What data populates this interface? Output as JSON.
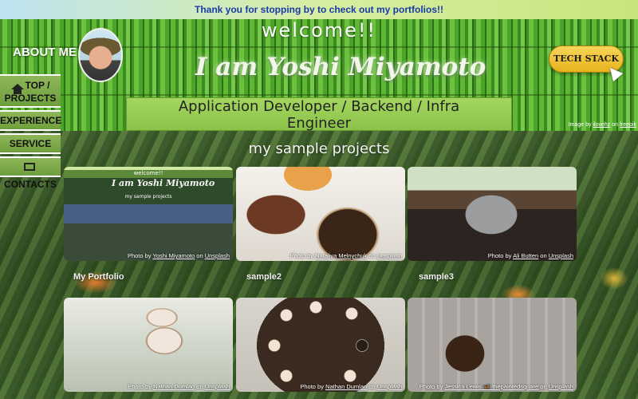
{
  "top_banner": {
    "text": "Thank you for stopping by to check out my portfolios!!"
  },
  "header": {
    "about_me": "ABOUT ME",
    "welcome": "welcome!!",
    "name": "I am Yoshi Miyamoto",
    "tech_stack_button": "TECH STACK",
    "role_line1": "Application Developer / Backend / Infra",
    "role_line2": "Engineer",
    "image_credit_prefix": "Image by",
    "image_credit_author": "ilovehz",
    "image_credit_on": "on",
    "image_credit_site": "freepik"
  },
  "sidebar": {
    "items": [
      {
        "label_line1": "TOP /",
        "label_line2": "PROJECTS",
        "icon": "home-icon"
      },
      {
        "label": "EXPERIENCE"
      },
      {
        "label": "SERVICE"
      },
      {
        "label": "CONTACTS",
        "icon": "monitor-icon"
      }
    ]
  },
  "projects": {
    "title": "my sample projects",
    "cards": [
      {
        "label": "My Portfolio",
        "credit_prefix": "Photo by",
        "author": "Yoshi Miyamoto",
        "on": "on",
        "site": "Unsplash",
        "mini_welcome": "welcome!!",
        "mini_name": "I am Yoshi Miyamoto",
        "mini_title": "my sample projects"
      },
      {
        "label": "sample2",
        "credit_prefix": "Photo by",
        "author": "Nataliya Melnychuk",
        "on": "on",
        "site": "Unsplash"
      },
      {
        "label": "sample3",
        "credit_prefix": "Photo by",
        "author": "Ali Butten",
        "on": "on",
        "site": "Unsplash"
      },
      {
        "label": "",
        "credit_prefix": "Photo by",
        "author": "Nathan Dumlao",
        "on": "on",
        "site": "Unsplash"
      },
      {
        "label": "",
        "credit_prefix": "Photo by",
        "author": "Nathan Dumlao",
        "on": "on",
        "site": "Unsplash"
      },
      {
        "label": "",
        "credit_prefix": "Photo by",
        "author": "Jessica Lewis 🦋 thepaintedsquare",
        "on": "on",
        "site": "Unsplash"
      }
    ]
  }
}
